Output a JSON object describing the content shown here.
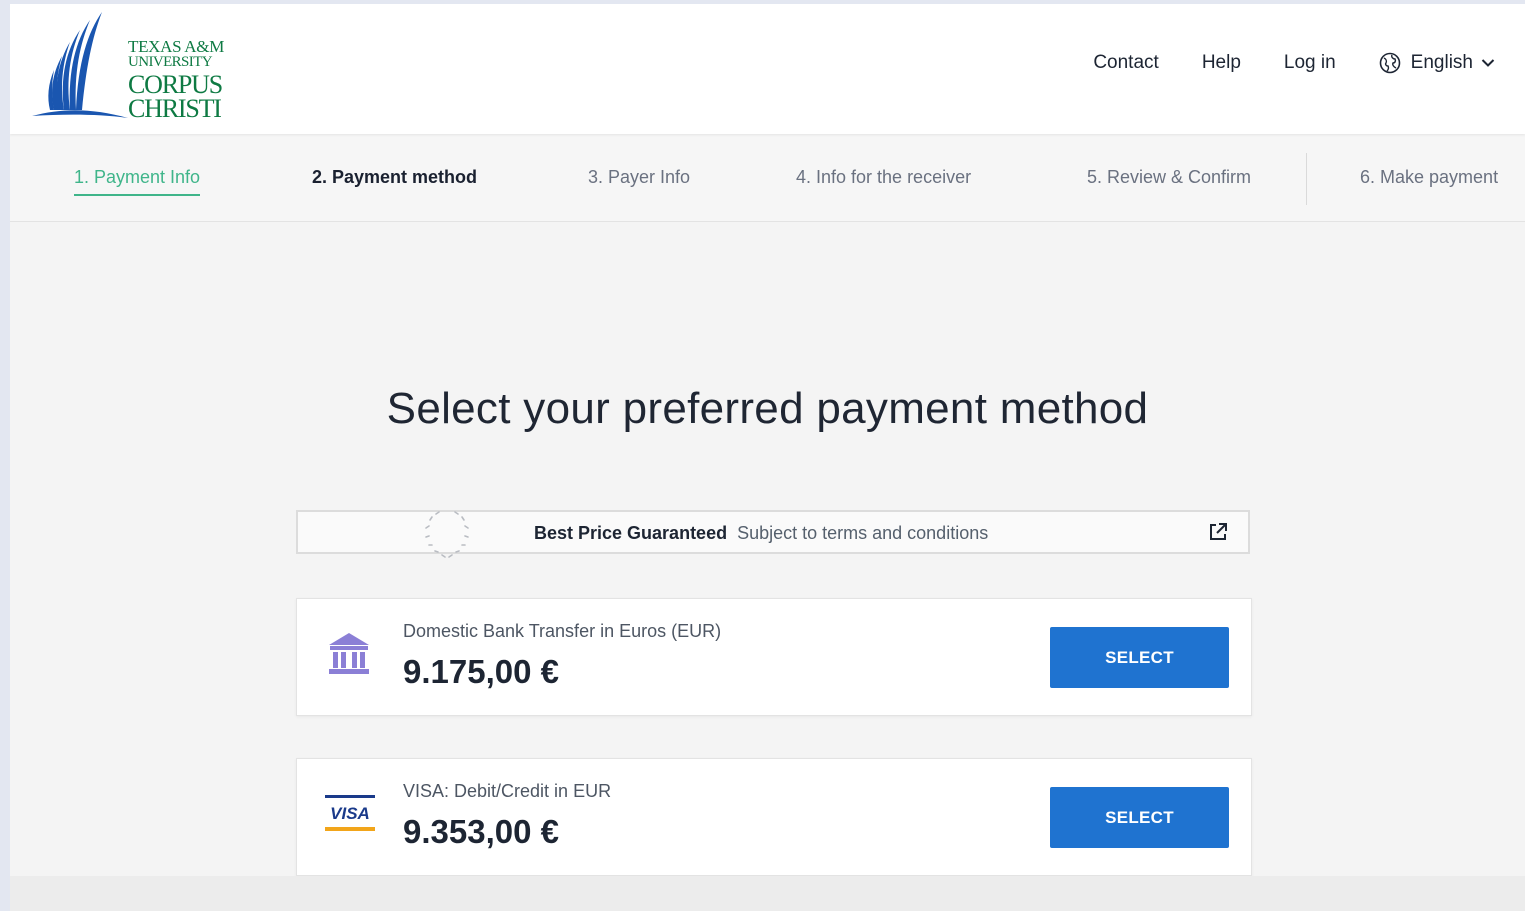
{
  "header": {
    "logo": {
      "line1": "TEXAS A&M",
      "line2": "UNIVERSITY",
      "line3": "CORPUS",
      "line4": "CHRISTI",
      "color": "#0e7a43",
      "accent": "#1a56b0"
    },
    "nav": {
      "contact": "Contact",
      "help": "Help",
      "login": "Log in",
      "language": "English"
    }
  },
  "steps": [
    {
      "label": "1. Payment Info",
      "state": "done"
    },
    {
      "label": "2. Payment method",
      "state": "active"
    },
    {
      "label": "3. Payer Info",
      "state": "pending"
    },
    {
      "label": "4. Info for the receiver",
      "state": "pending"
    },
    {
      "label": "5. Review & Confirm",
      "state": "pending"
    },
    {
      "label": "6. Make payment",
      "state": "pending"
    }
  ],
  "main": {
    "title": "Select your preferred payment method",
    "guarantee": {
      "bold": "Best Price Guaranteed",
      "text": "Subject to terms and conditions"
    },
    "options": [
      {
        "icon": "bank-icon",
        "label": "Domestic Bank Transfer in Euros (EUR)",
        "amount": "9.175,00 €",
        "button": "SELECT"
      },
      {
        "icon": "visa-icon",
        "label": "VISA: Debit/Credit in EUR",
        "amount": "9.353,00 €",
        "button": "SELECT"
      }
    ]
  },
  "colors": {
    "accent_green": "#3fb58a",
    "button_blue": "#1f73d0",
    "bank_icon_purple": "#8b7fd6"
  }
}
